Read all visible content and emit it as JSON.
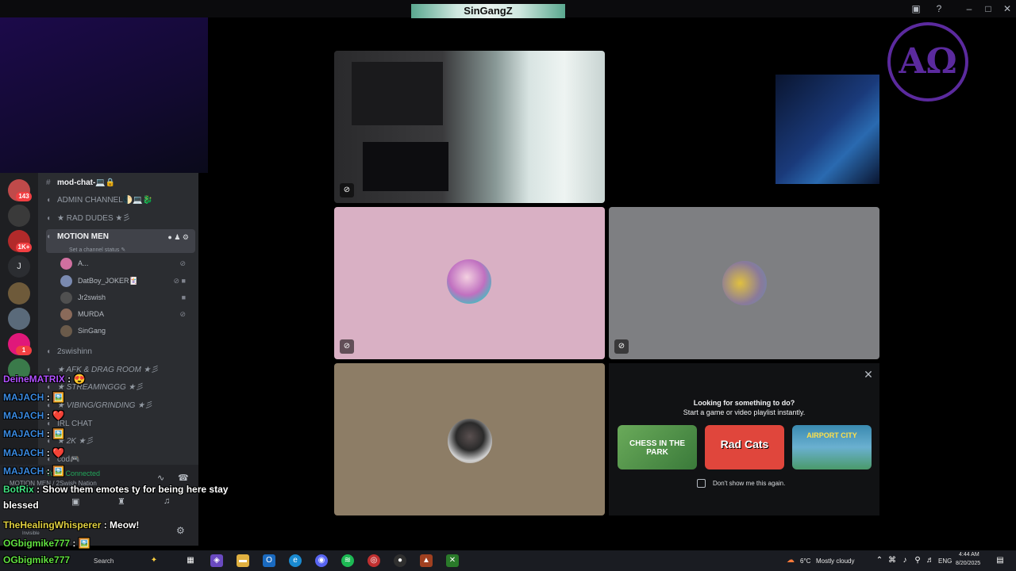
{
  "window": {
    "title": "SinGangZ"
  },
  "discord": {
    "servers": [
      {
        "badge": "143",
        "color": "#c04a4a"
      },
      {
        "badge": "",
        "color": "#3a3a3a"
      },
      {
        "badge": "1K+",
        "color": "#b22a2a"
      },
      {
        "badge": "",
        "label": "J",
        "color": "#2b2d31"
      },
      {
        "badge": "",
        "color": "#6e5a3a"
      },
      {
        "badge": "",
        "color": "#5a6a7a"
      },
      {
        "badge": "1",
        "color": "#e0187a"
      },
      {
        "badge": "",
        "color": "#3a7a4a"
      }
    ],
    "channels": [
      {
        "name": "mod-chat-💻🔒",
        "icon": "#",
        "type": "text"
      },
      {
        "name": "ADMIN CHANNEL🌓💻🐉",
        "icon": "🔊",
        "type": "voice"
      },
      {
        "name": "★ RAD DUDES ★彡",
        "icon": "🔊",
        "type": "voice"
      }
    ],
    "active_channel": {
      "name": "MOTION MEN",
      "status": "Set a channel status ✎"
    },
    "members": [
      {
        "name": "A...",
        "color": "#d070a0"
      },
      {
        "name": "DatBoy_JOKER🃏",
        "color": "#7a8ab0"
      },
      {
        "name": "Jr2swish",
        "color": "#505050"
      },
      {
        "name": "MURDA",
        "color": "#8a6a5a"
      },
      {
        "name": "SinGang",
        "color": "#6a5a4a"
      }
    ],
    "channels_after": [
      {
        "name": "2swishinn"
      },
      {
        "name": "★ AFK & DRAG ROOM ★彡"
      },
      {
        "name": "★ STREAMINGGG ★彡"
      },
      {
        "name": "★ VIBING/GRINDING ★彡"
      },
      {
        "name": "IRL CHAT"
      },
      {
        "name": "★ 2K ★彡"
      },
      {
        "name": "cod🎮"
      }
    ],
    "voice_panel": {
      "status": "Voice Connected",
      "channel": "MOTION MEN / 2Swish Nation",
      "user_status": "Invisible"
    }
  },
  "activity": {
    "line1": "Looking for something to do?",
    "line2": "Start a game or video playlist instantly.",
    "games": [
      {
        "name": "CHESS IN THE PARK",
        "bg": "#4a8a3a"
      },
      {
        "name": "Rad Cats",
        "bg": "#e0463c"
      },
      {
        "name": "AIRPORT CITY",
        "bg": "#3a8ab0"
      }
    ],
    "dont_show": "Don't show me this again."
  },
  "chat": [
    {
      "user": "DeineMATRIX",
      "sep": ":",
      "msg": "😍",
      "color": "#b050ff"
    },
    {
      "user": "MAJACH",
      "sep": ":",
      "msg": "🖼️",
      "color": "#3a8ae0"
    },
    {
      "user": "MAJACH",
      "sep": ":",
      "msg": "❤️",
      "color": "#3a8ae0"
    },
    {
      "user": "MAJACH",
      "sep": ":",
      "msg": "🖼️",
      "color": "#3a8ae0"
    },
    {
      "user": "MAJACH",
      "sep": ":",
      "msg": "❤️",
      "color": "#3a8ae0"
    },
    {
      "user": "MAJACH",
      "sep": ":",
      "msg": "🖼️",
      "color": "#3a8ae0"
    },
    {
      "user": "BotRix",
      "sep": ":",
      "msg": "Show them emotes ty for being here stay",
      "color": "#40e080"
    },
    {
      "user": "",
      "sep": "",
      "msg": "blessed",
      "color": "#ffffff"
    },
    {
      "user": "TheHealingWhisperer",
      "sep": ":",
      "msg": "Meow!",
      "color": "#e0d040"
    },
    {
      "user": "OGbigmike777",
      "sep": ":",
      "msg": "🖼️",
      "color": "#60e040"
    },
    {
      "user": "OGbigmike777",
      "sep": ":",
      "msg": "",
      "color": "#60e040"
    }
  ],
  "taskbar": {
    "search": "Search",
    "weather_temp": "6°C",
    "weather_desc": "Mostly cloudy",
    "lang": "ENG",
    "time": "4:44 AM",
    "date": "8/20/2025"
  },
  "colors": {
    "tile_pink": "#d9b0c4",
    "tile_gray": "#7e7f82",
    "tile_tan": "#8d7d66",
    "accent_purple": "#5b2a9e"
  }
}
